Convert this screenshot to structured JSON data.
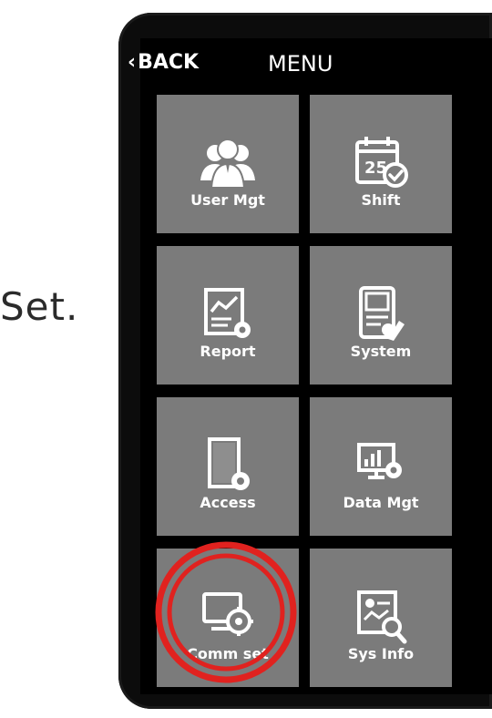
{
  "caption": {
    "side_text": "Set."
  },
  "screen": {
    "back_label": "BACK",
    "title": "MENU"
  },
  "tiles": [
    {
      "label": "User Mgt",
      "icon": "users-icon"
    },
    {
      "label": "Shift",
      "icon": "calendar-check-icon"
    },
    {
      "label": "Report",
      "icon": "report-chart-icon"
    },
    {
      "label": "System",
      "icon": "system-settings-icon"
    },
    {
      "label": "Access",
      "icon": "door-gear-icon"
    },
    {
      "label": "Data Mgt",
      "icon": "data-monitor-icon"
    },
    {
      "label": "Comm set",
      "icon": "comm-gear-icon"
    },
    {
      "label": "Sys Info",
      "icon": "sys-info-icon"
    }
  ],
  "colors": {
    "tile": "#7b7b7b",
    "highlight": "#e0221f",
    "background": "#000000"
  }
}
